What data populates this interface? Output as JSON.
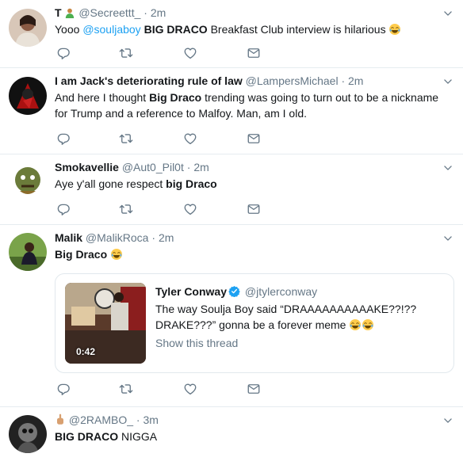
{
  "tweets": [
    {
      "name": "T",
      "handle": "@Secreettt_",
      "dot": "·",
      "time": "2m",
      "text": [
        {
          "t": "Yooo ",
          "b": false
        },
        {
          "t": "@souljaboy",
          "b": false,
          "link": true
        },
        {
          "t": " ",
          "b": false
        },
        {
          "t": "BIG DRACO",
          "b": true
        },
        {
          "t": " Breakfast Club interview is hilarious ",
          "b": false
        }
      ],
      "emoji": "crying-laughing-emoji"
    },
    {
      "name": "I am Jack's deteriorating rule of law",
      "handle": "@LampersMichael",
      "dot": "·",
      "time": "2m",
      "text_a": "And here I thought ",
      "text_b": "Big Draco",
      "text_c": " trending was going to turn out to be a nickname for Trump and a reference to Malfoy. Man, am I old."
    },
    {
      "name": "Smokavellie",
      "handle": "@Aut0_Pil0t",
      "dot": "·",
      "time": "2m",
      "text_a": "Aye y'all gone respect ",
      "text_b": "big Draco"
    },
    {
      "name": "Malik",
      "handle": "@MalikRoca",
      "dot": "·",
      "time": "2m",
      "text_b": "Big Draco",
      "quote": {
        "name": "Tyler Conway",
        "handle": "@jtylerconway",
        "text": "The way Soulja Boy said “DRAAAAAAAAAAKE??!?? DRAKE???” gonna be a forever meme",
        "show_thread": "Show this thread",
        "duration": "0:42"
      }
    },
    {
      "name": "",
      "handle": "@2RAMBO_",
      "dot": "·",
      "time": "3m",
      "text_b": "BIG DRACO",
      "text_c": " NIGGA"
    }
  ],
  "colors": {
    "text": "#14171a",
    "muted": "#657786",
    "link": "#1da1f2",
    "border": "#e6ecf0"
  },
  "icons": [
    "reply-icon",
    "retweet-icon",
    "like-icon",
    "direct-message-icon",
    "caret-down-icon",
    "verified-badge-icon"
  ]
}
